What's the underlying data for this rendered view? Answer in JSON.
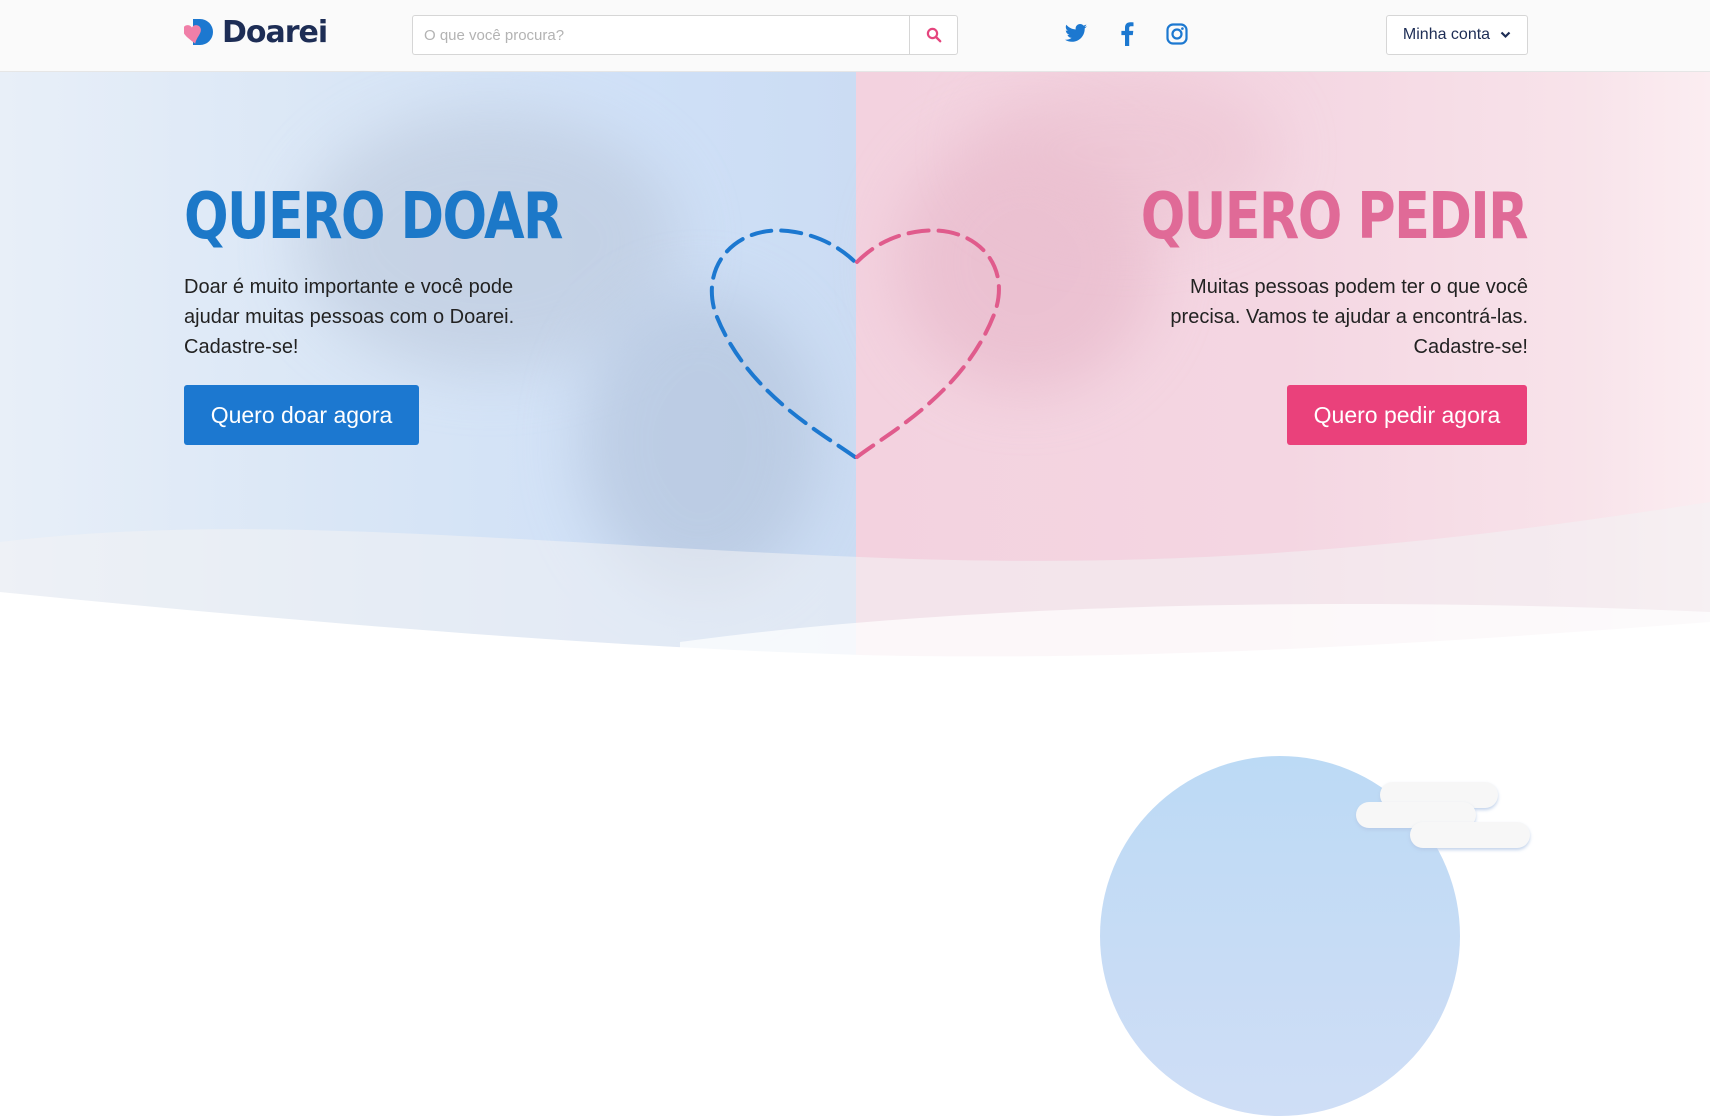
{
  "header": {
    "logo_text": "Doarei",
    "search_placeholder": "O que você procura?",
    "account_label": "Minha conta",
    "social": [
      "twitter-icon",
      "facebook-icon",
      "instagram-icon"
    ]
  },
  "hero": {
    "left": {
      "title": "QUERO DOAR",
      "description": "Doar é muito importante e você pode ajudar muitas pessoas com o Doarei. Cadastre-se!",
      "button": "Quero doar agora"
    },
    "right": {
      "title": "QUERO PEDIR",
      "description": "Muitas pessoas podem ter o que você precisa. Vamos te ajudar a encontrá-las. Cadastre-se!",
      "button": "Quero pedir agora"
    }
  },
  "colors": {
    "blue": "#1c78d0",
    "pink": "#ea417b",
    "brand_dark": "#1d2d55"
  }
}
